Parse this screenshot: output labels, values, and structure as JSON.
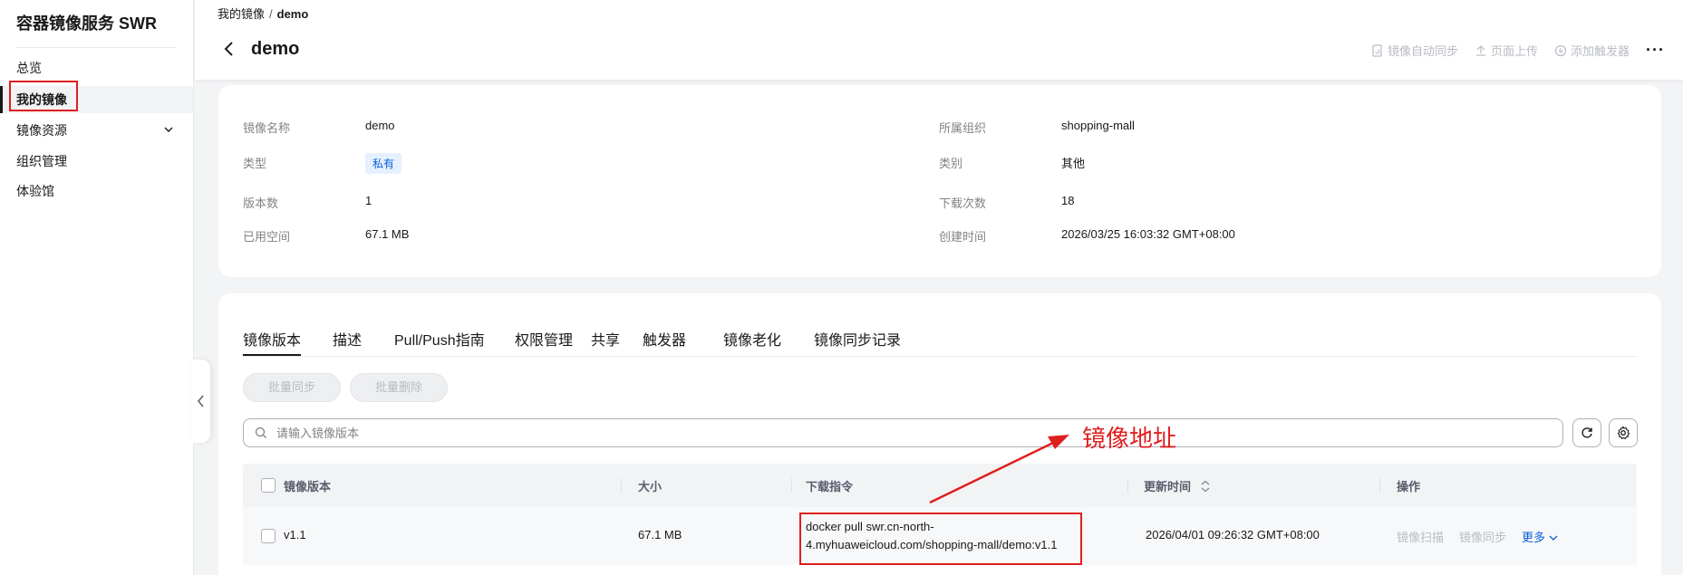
{
  "sidebar": {
    "app_title": "容器镜像服务 SWR",
    "items": [
      {
        "label": "总览"
      },
      {
        "label": "我的镜像"
      },
      {
        "label": "镜像资源"
      },
      {
        "label": "组织管理"
      },
      {
        "label": "体验馆"
      }
    ]
  },
  "header": {
    "breadcrumb": [
      "我的镜像",
      "/",
      "demo"
    ],
    "title": "demo",
    "actions": [
      {
        "label": "镜像自动同步"
      },
      {
        "label": "页面上传"
      },
      {
        "label": "添加触发器"
      }
    ],
    "more": "···"
  },
  "info": {
    "left": [
      {
        "label": "镜像名称",
        "value": "demo"
      },
      {
        "label": "类型",
        "value": "私有"
      },
      {
        "label": "版本数",
        "value": "1"
      },
      {
        "label": "已用空间",
        "value": "67.1 MB"
      }
    ],
    "right": [
      {
        "label": "所属组织",
        "value": "shopping-mall"
      },
      {
        "label": "类别",
        "value": "其他"
      },
      {
        "label": "下载次数",
        "value": "18"
      },
      {
        "label": "创建时间",
        "value": "2026/03/25 16:03:32 GMT+08:00"
      }
    ]
  },
  "tabs": [
    {
      "label": "镜像版本"
    },
    {
      "label": "描述"
    },
    {
      "label": "Pull/Push指南"
    },
    {
      "label": "权限管理"
    },
    {
      "label": "共享"
    },
    {
      "label": "触发器"
    },
    {
      "label": "镜像老化"
    },
    {
      "label": "镜像同步记录"
    }
  ],
  "toolbar": {
    "batch_sync": "批量同步",
    "batch_delete": "批量删除"
  },
  "search": {
    "placeholder": "请输入镜像版本",
    "value": ""
  },
  "table": {
    "columns": [
      "镜像版本",
      "大小",
      "下载指令",
      "更新时间",
      "操作"
    ],
    "rows": [
      {
        "version": "v1.1",
        "size": "67.1 MB",
        "command": "docker pull swr.cn-north-4.myhuaweicloud.com/shopping-mall/demo:v1.1",
        "updated": "2026/04/01 09:26:32 GMT+08:00",
        "ops": [
          "镜像扫描",
          "镜像同步",
          "更多"
        ]
      }
    ]
  },
  "annotation": {
    "text": "镜像地址",
    "color": "#e01f1f"
  },
  "colors": {
    "accent_blue": "#0a5cdb",
    "annotation_red": "#e01f1f",
    "tag_bg": "#e6f0ff"
  }
}
